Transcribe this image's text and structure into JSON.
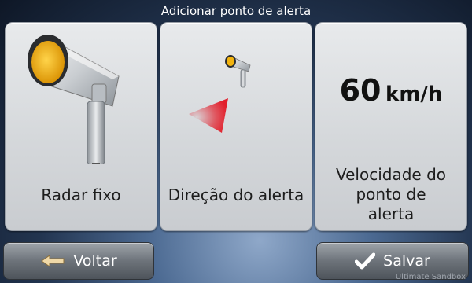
{
  "header": {
    "title": "Adicionar ponto de alerta"
  },
  "tiles": [
    {
      "label": "Radar fixo"
    },
    {
      "label": "Direção do alerta"
    },
    {
      "speed_value": "60",
      "speed_unit": "km/h",
      "label_lines": [
        "Velocidade do",
        "ponto de",
        "alerta"
      ]
    }
  ],
  "footer": {
    "back_label": "Voltar",
    "save_label": "Salvar"
  },
  "watermark": "Ultimate Sandbox",
  "icons": {
    "camera": "speed-camera-icon",
    "direction": "direction-cone-icon",
    "back": "back-arrow-icon",
    "save": "checkmark-icon"
  },
  "colors": {
    "camera_lens": "#f2b30e",
    "direction_cone": "#e21f2b"
  }
}
